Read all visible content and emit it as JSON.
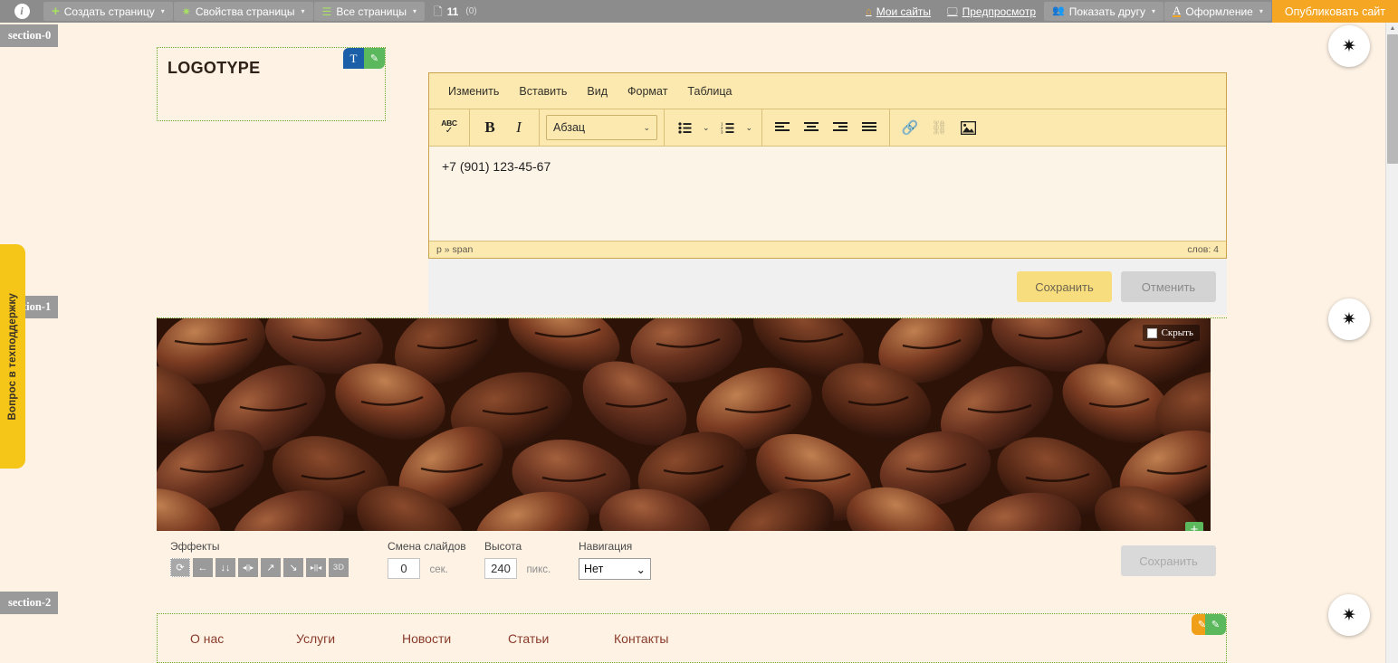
{
  "topbar": {
    "info_icon": "info-icon",
    "buttons": [
      {
        "label": "Создать страницу",
        "icon": "plus-icon",
        "caret": "▾"
      },
      {
        "label": "Свойства страницы",
        "icon": "gear-icon",
        "caret": "▾"
      },
      {
        "label": "Все страницы",
        "icon": "burger-icon",
        "caret": "▾"
      }
    ],
    "page_count": "11",
    "page_count_sub": "(0)",
    "links": [
      {
        "label": "Мои сайты",
        "icon": "home-icon"
      },
      {
        "label": "Предпросмотр",
        "icon": "monitor-icon"
      }
    ],
    "menus": [
      {
        "label": "Показать другу",
        "icon": "people-icon",
        "caret": "▾"
      },
      {
        "label": "Оформление",
        "icon": "font-a-icon",
        "caret": "▾"
      }
    ],
    "publish_label": "Опубликовать сайт"
  },
  "sections": {
    "labels": [
      "section-0",
      "section-1",
      "section-2"
    ]
  },
  "support_tab": {
    "label": "Вопрос в техподдержку"
  },
  "gear_fabs": {
    "icon": "gear-icon",
    "glyph": "✷"
  },
  "logo": {
    "text": "LOGOTYPE",
    "badge_text": "T",
    "badge_pencil": "✎"
  },
  "editor": {
    "menu": [
      "Изменить",
      "Вставить",
      "Вид",
      "Формат",
      "Таблица"
    ],
    "toolbar": {
      "spellcheck": {
        "abc": "ABC",
        "check": "✓",
        "name": "spellcheck-icon"
      },
      "bold": "B",
      "italic": "I",
      "paragraph_value": "Абзац",
      "paragraph_caret": "⌄",
      "bullet_list": "bullet-list-icon",
      "numbered_list": "numbered-list-icon",
      "align_left": "align-left-icon",
      "align_center": "align-center-icon",
      "align_right": "align-right-icon",
      "align_justify": "align-justify-icon",
      "link": "🔗",
      "unlink": "⛓",
      "image": "🖼"
    },
    "content": "+7 (901) 123-45-67",
    "status_path": "p » span",
    "status_words": "слов: 4"
  },
  "savebar": {
    "save_label": "Сохранить",
    "cancel_label": "Отменить"
  },
  "slider": {
    "hide_label": "Скрыть",
    "plus_label": "+",
    "effects_label": "Эффекты",
    "effects": [
      {
        "glyph": "⟳",
        "name": "effect-shuffle",
        "selected": true
      },
      {
        "glyph": "←",
        "name": "effect-slide-left",
        "selected": false
      },
      {
        "glyph": "↓↓",
        "name": "effect-slide-down",
        "selected": false
      },
      {
        "glyph": "◂||▸",
        "name": "effect-split-out",
        "selected": false
      },
      {
        "glyph": "↗",
        "name": "effect-zoom-in",
        "selected": false
      },
      {
        "glyph": "↘",
        "name": "effect-zoom-out",
        "selected": false
      },
      {
        "glyph": "▸||◂",
        "name": "effect-split-in",
        "selected": false
      },
      {
        "glyph": "3D",
        "name": "effect-3d",
        "selected": false
      }
    ],
    "change_label": "Смена слайдов",
    "change_value": "0",
    "change_unit": "сек.",
    "height_label": "Высота",
    "height_value": "240",
    "height_unit": "пикс.",
    "nav_label": "Навигация",
    "nav_value": "Нет",
    "nav_caret": "⌄",
    "save_label": "Сохранить"
  },
  "nav_section": {
    "items": [
      "О нас",
      "Услуги",
      "Новости",
      "Статьи",
      "Контакты"
    ],
    "badge_orange": "✎",
    "badge_green": "✎"
  },
  "scrollbar": {
    "up": "▲",
    "down": "▼"
  },
  "colors": {
    "accent_orange": "#f5a623",
    "topbar_grey": "#8c8c8c",
    "page_bg": "#fdf2e4",
    "editor_yellow": "#fbe9b0",
    "nav_link": "#8a3a2a",
    "green": "#5cb85c"
  }
}
